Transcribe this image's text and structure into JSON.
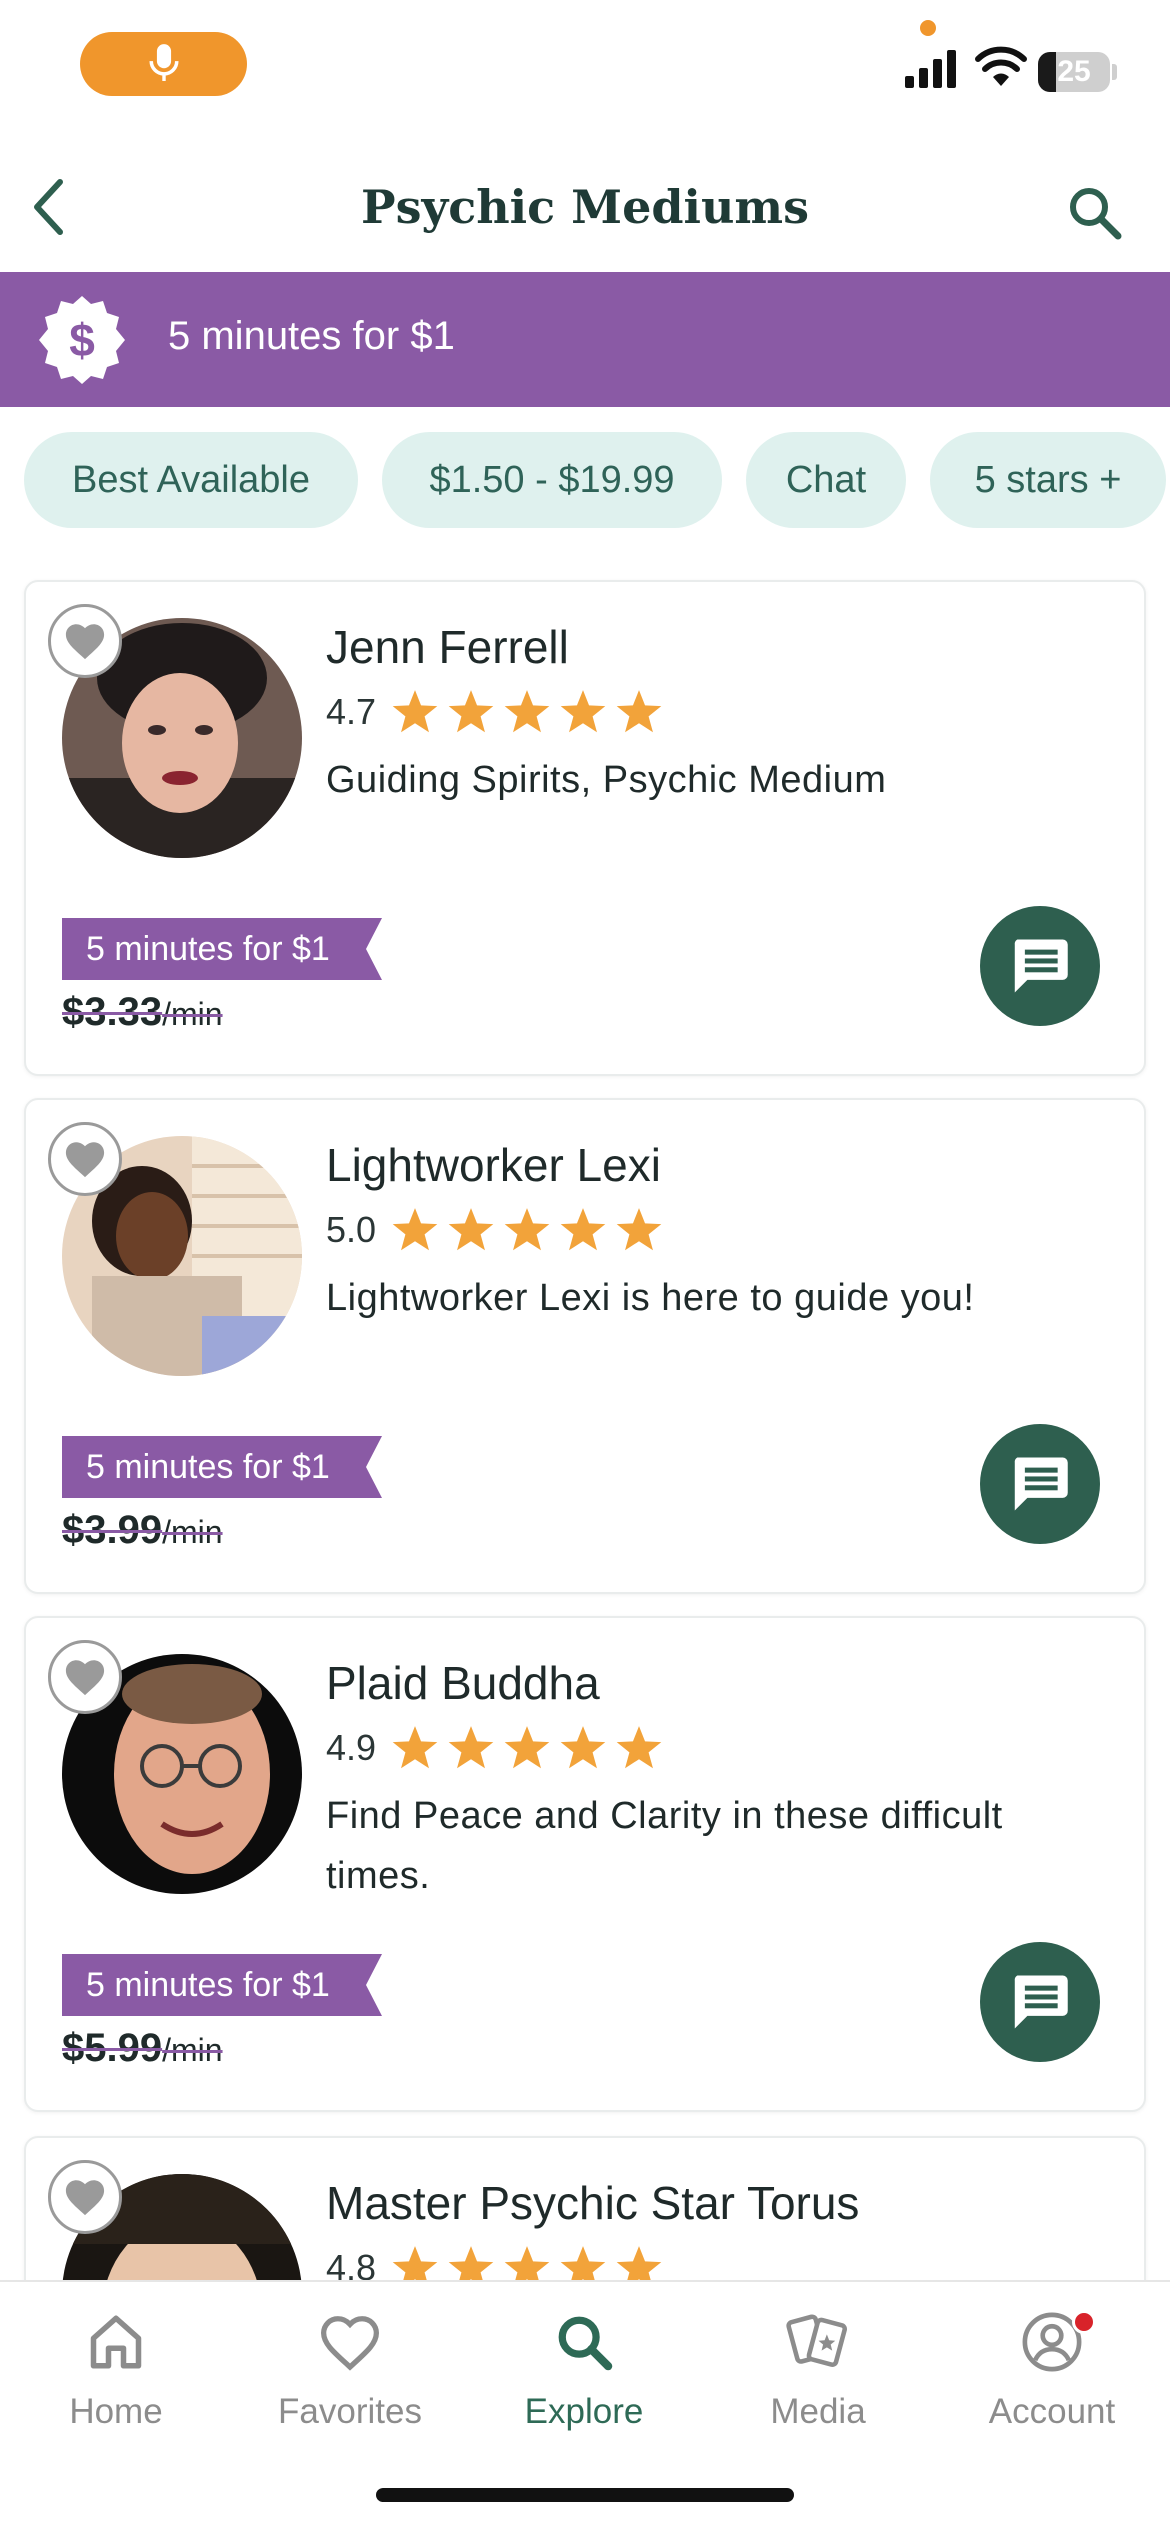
{
  "status_bar": {
    "battery_level": "25"
  },
  "header": {
    "title": "Psychic Mediums"
  },
  "promo_banner": {
    "text": "5 minutes for $1"
  },
  "filters": [
    "Best Available",
    "$1.50 - $19.99",
    "Chat",
    "5 stars +"
  ],
  "readers": [
    {
      "name": "Jenn Ferrell",
      "rating": "4.7",
      "stars": 5,
      "tagline": "Guiding Spirits, Psychic Medium",
      "promo": "5 minutes for $1",
      "price": "$3.33",
      "per_min": "/min"
    },
    {
      "name": "Lightworker Lexi",
      "rating": "5.0",
      "stars": 5,
      "tagline": "Lightworker Lexi is here to guide you!",
      "promo": "5 minutes for $1",
      "price": "$3.99",
      "per_min": "/min"
    },
    {
      "name": "Plaid Buddha",
      "rating": "4.9",
      "stars": 5,
      "tagline": "Find Peace and Clarity in these difficult times.",
      "promo": "5 minutes for $1",
      "price": "$5.99",
      "per_min": "/min"
    },
    {
      "name": "Master Psychic Star Torus",
      "rating": "4.8",
      "stars": 5
    }
  ],
  "bottom_nav": {
    "items": [
      {
        "label": "Home",
        "icon": "home-icon"
      },
      {
        "label": "Favorites",
        "icon": "heart-icon"
      },
      {
        "label": "Explore",
        "icon": "search-icon",
        "active": true
      },
      {
        "label": "Media",
        "icon": "tarot-cards-icon"
      },
      {
        "label": "Account",
        "icon": "account-icon",
        "has_notification": true
      }
    ]
  },
  "colors": {
    "brand_purple": "#8a5aa5",
    "brand_green": "#2e5f4f",
    "chip_bg": "#dff1ee",
    "star": "#f2a33a",
    "mic_orange": "#f0962c",
    "notification_red": "#d8232a"
  }
}
